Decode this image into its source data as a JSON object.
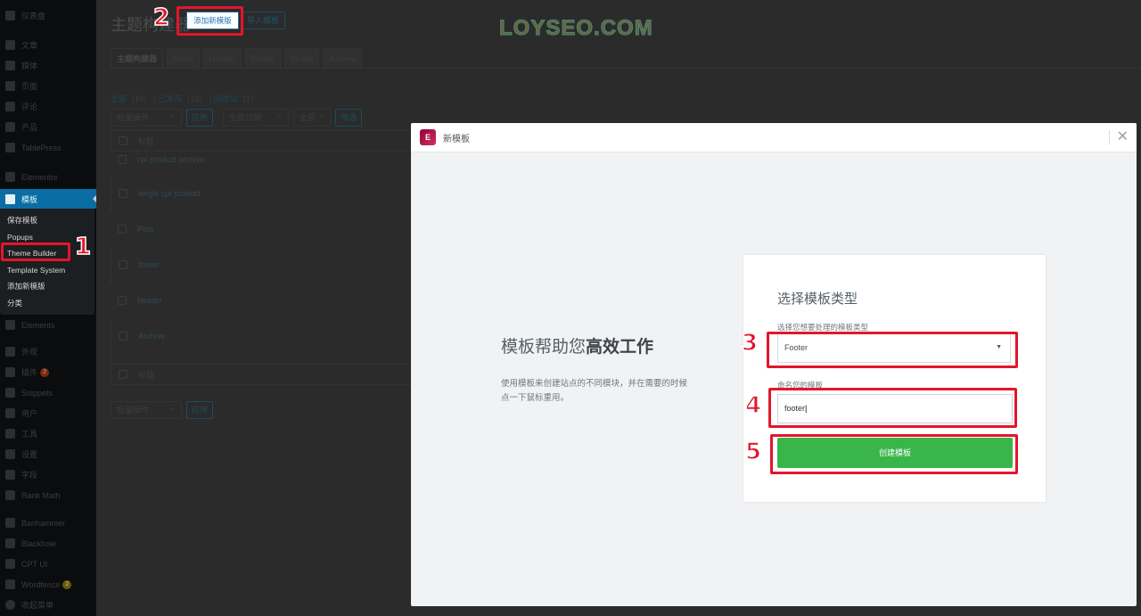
{
  "sidebar": {
    "items_top": [
      {
        "label": "仪表盘",
        "icon": "dashboard-icon"
      },
      {
        "label": "文章",
        "icon": "pin-icon"
      },
      {
        "label": "媒体",
        "icon": "media-icon"
      },
      {
        "label": "页面",
        "icon": "page-icon"
      },
      {
        "label": "评论",
        "icon": "comment-icon"
      },
      {
        "label": "产品",
        "icon": "pin-icon"
      },
      {
        "label": "TablePress",
        "icon": "table-icon"
      },
      {
        "label": "Elementor",
        "icon": "elementor-icon"
      }
    ],
    "active": {
      "label": "模板",
      "icon": "folder-icon"
    },
    "submenu": [
      "保存模板",
      "Popups",
      "Theme Builder",
      "Template System",
      "添加新模版",
      "分类"
    ],
    "items_bottom": [
      {
        "label": "Elements",
        "icon": "elements-icon"
      },
      {
        "label": "外观",
        "icon": "brush-icon"
      },
      {
        "label": "插件",
        "icon": "plugin-icon",
        "badge": "2"
      },
      {
        "label": "Snippets",
        "icon": "scissors-icon"
      },
      {
        "label": "用户",
        "icon": "user-icon"
      },
      {
        "label": "工具",
        "icon": "wrench-icon"
      },
      {
        "label": "设置",
        "icon": "settings-icon"
      },
      {
        "label": "字段",
        "icon": "fields-icon"
      },
      {
        "label": "Rank Math",
        "icon": "chart-icon"
      },
      {
        "label": "Banhammer",
        "icon": "hammer-icon"
      },
      {
        "label": "Blackhole",
        "icon": "gear-icon"
      },
      {
        "label": "CPT UI",
        "icon": "grid-icon"
      },
      {
        "label": "Wordfence",
        "icon": "shield-icon",
        "badge": "2"
      },
      {
        "label": "收起菜单",
        "icon": "collapse-icon"
      }
    ]
  },
  "header": {
    "title": "主题构建器",
    "add_new": "添加新模版",
    "import": "导入模板"
  },
  "watermark": "LOYSEO.COM",
  "tabs": [
    "主题构建器",
    "Email",
    "Header",
    "Footer",
    "Single",
    "Archive"
  ],
  "status_links": {
    "all": "全部",
    "all_count": "（19）",
    "published": "已发布",
    "published_count": "（19）",
    "trash": "回收站",
    "trash_count": "（1）"
  },
  "toolbar": {
    "bulk_action": "批量操作",
    "apply": "应用",
    "all_dates": "全部日期",
    "all": "全部",
    "filter": "筛选"
  },
  "table": {
    "header": "标题",
    "rows": [
      "cpi product archive",
      "single cpi product",
      "Post",
      "footer",
      "header",
      "Archive"
    ]
  },
  "modal": {
    "title": "新模板",
    "intro_title_plain": "模板帮助您",
    "intro_title_bold": "高效工作",
    "intro_desc": "使用模板来创建站点的不同模块，并在需要的时候点一下鼠标重用。",
    "form_title": "选择模板类型",
    "type_label": "选择您想要处理的模板类型",
    "type_value": "Footer",
    "name_label": "命名您的模板",
    "name_value": "footer",
    "create_button": "创建模板"
  },
  "annotations": [
    "1",
    "2",
    "3",
    "4",
    "5"
  ],
  "colors": {
    "accent": "#0a6ea5",
    "annotation": "#e3162a",
    "create_button": "#39b54a"
  }
}
